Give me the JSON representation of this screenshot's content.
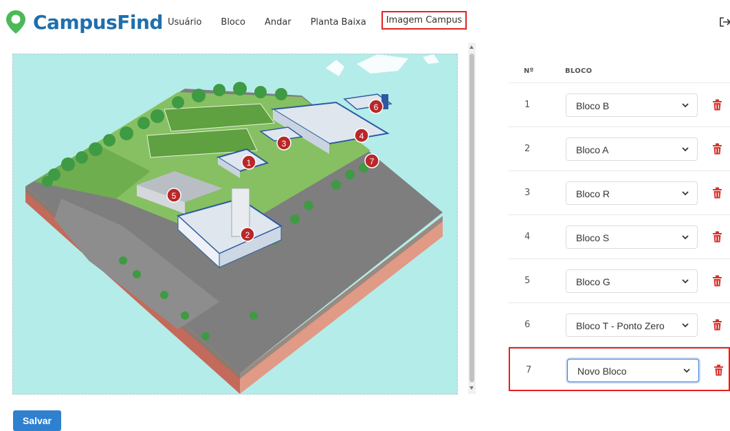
{
  "app": {
    "name": "CampusFind",
    "accent_color": "#1f6fad",
    "logo_pin_color": "#4bb957"
  },
  "nav": {
    "items": [
      {
        "label": "Usuário",
        "active": false
      },
      {
        "label": "Bloco",
        "active": false
      },
      {
        "label": "Andar",
        "active": false
      },
      {
        "label": "Planta Baixa",
        "active": false
      },
      {
        "label": "Imagem Campus",
        "active": true
      }
    ],
    "logout_icon": "logout-icon"
  },
  "campus_map": {
    "markers": [
      "1",
      "2",
      "3",
      "4",
      "5",
      "6",
      "7"
    ]
  },
  "table": {
    "headers": {
      "number": "Nº",
      "block": "BLOCO"
    },
    "rows": [
      {
        "number": "1",
        "block": "Bloco B"
      },
      {
        "number": "2",
        "block": "Bloco A"
      },
      {
        "number": "3",
        "block": "Bloco R"
      },
      {
        "number": "4",
        "block": "Bloco S"
      },
      {
        "number": "5",
        "block": "Bloco G"
      },
      {
        "number": "6",
        "block": "Bloco T - Ponto Zero"
      },
      {
        "number": "7",
        "block": "Novo Bloco",
        "highlighted": true
      }
    ],
    "delete_icon": "trash-icon",
    "delete_color": "#d9312b"
  },
  "actions": {
    "save_label": "Salvar"
  }
}
